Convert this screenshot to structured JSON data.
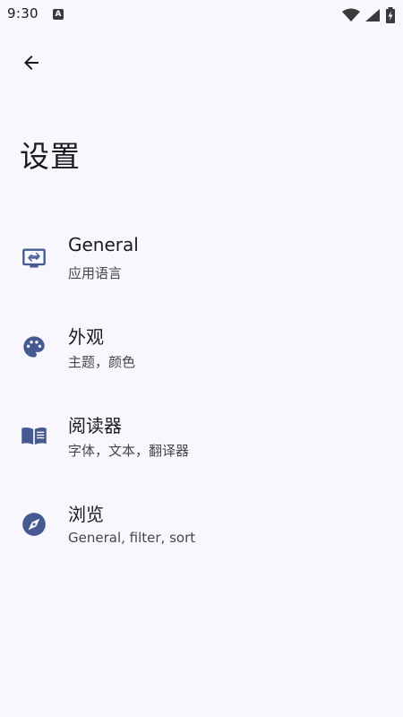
{
  "status_bar": {
    "time": "9:30",
    "notification_icon": "A",
    "icons": [
      "wifi-icon",
      "signal-icon",
      "battery-charging-icon"
    ]
  },
  "toolbar": {
    "back_icon": "arrow-back-icon"
  },
  "page": {
    "title": "设置"
  },
  "settings": {
    "items": [
      {
        "title": "General",
        "subtitle": "应用语言",
        "icon": "language-display-icon"
      },
      {
        "title": "外观",
        "subtitle": "主题，颜色",
        "icon": "palette-icon"
      },
      {
        "title": "阅读器",
        "subtitle": "字体，文本，翻译器",
        "icon": "book-icon"
      },
      {
        "title": "浏览",
        "subtitle": "General, filter, sort",
        "icon": "compass-icon"
      }
    ]
  },
  "colors": {
    "background": "#f8f7fd",
    "accent": "#465a92",
    "text_primary": "#1b1b1f",
    "text_secondary": "#46464f"
  }
}
